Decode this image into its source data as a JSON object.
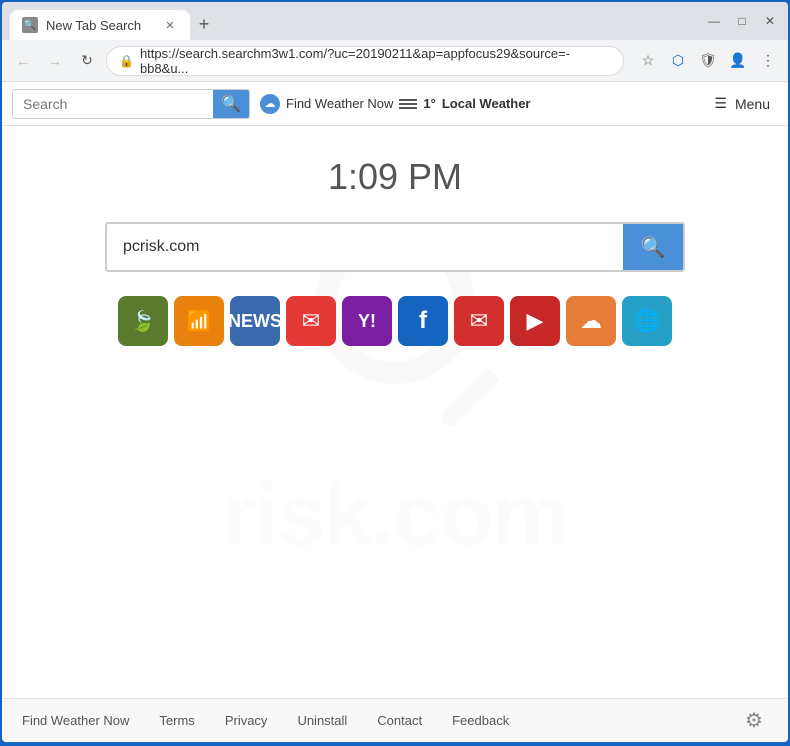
{
  "browser": {
    "tab_label": "New Tab Search",
    "tab_favicon": "🔍",
    "url": "https://search.searchm3w1.com/?uc=20190211&ap=appfocus29&source=-bb8&u...",
    "new_tab_icon": "+",
    "win_minimize": "—",
    "win_maximize": "□",
    "win_close": "✕"
  },
  "toolbar": {
    "search_placeholder": "Search",
    "search_icon": "🔍",
    "weather_label": "Find Weather Now",
    "temperature": "1°",
    "local_weather": "Local Weather",
    "menu_label": "Menu",
    "menu_icon": "☰"
  },
  "page": {
    "time": "1:09 PM",
    "search_value": "pcrisk.com",
    "watermark_text": "risk.com"
  },
  "shortcuts": [
    {
      "id": "shortcut-1",
      "label": "Leaf",
      "icon": "🍃",
      "class": "sc-green"
    },
    {
      "id": "shortcut-2",
      "label": "Audible",
      "icon": "📶",
      "class": "sc-orange"
    },
    {
      "id": "shortcut-3",
      "label": "News",
      "icon": "📰",
      "class": "sc-news"
    },
    {
      "id": "shortcut-4",
      "label": "Gmail",
      "icon": "✉",
      "class": "sc-gmail"
    },
    {
      "id": "shortcut-5",
      "label": "Yahoo",
      "icon": "Y!",
      "class": "sc-yahoo"
    },
    {
      "id": "shortcut-6",
      "label": "Facebook",
      "icon": "f",
      "class": "sc-facebook"
    },
    {
      "id": "shortcut-7",
      "label": "Gmail2",
      "icon": "✉",
      "class": "sc-gmail2"
    },
    {
      "id": "shortcut-8",
      "label": "YouTube",
      "icon": "▶",
      "class": "sc-youtube"
    },
    {
      "id": "shortcut-9",
      "label": "Weather",
      "icon": "☁",
      "class": "sc-weather"
    },
    {
      "id": "shortcut-10",
      "label": "Globe",
      "icon": "🌐",
      "class": "sc-globe"
    }
  ],
  "footer": {
    "links": [
      {
        "label": "Find Weather Now"
      },
      {
        "label": "Terms"
      },
      {
        "label": "Privacy"
      },
      {
        "label": "Uninstall"
      },
      {
        "label": "Contact"
      },
      {
        "label": "Feedback"
      }
    ],
    "gear_icon": "⚙"
  }
}
